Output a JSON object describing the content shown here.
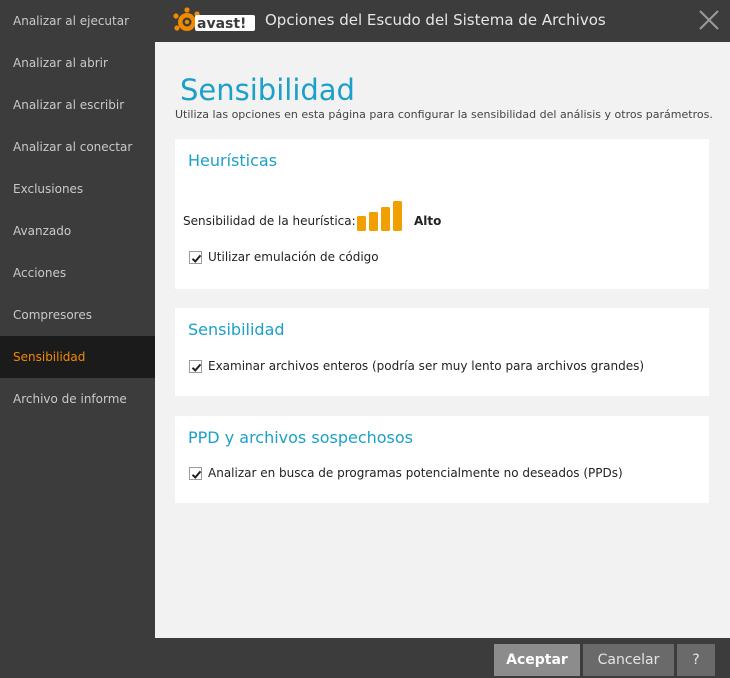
{
  "window": {
    "title": "Opciones del Escudo del Sistema de Archivos",
    "brand": "avast!"
  },
  "sidebar": {
    "items": [
      {
        "label": "Analizar al ejecutar"
      },
      {
        "label": "Analizar al abrir"
      },
      {
        "label": "Analizar al escribir"
      },
      {
        "label": "Analizar al conectar"
      },
      {
        "label": "Exclusiones"
      },
      {
        "label": "Avanzado"
      },
      {
        "label": "Acciones"
      },
      {
        "label": "Compresores"
      },
      {
        "label": "Sensibilidad",
        "active": true
      },
      {
        "label": "Archivo de informe"
      }
    ]
  },
  "page": {
    "title": "Sensibilidad",
    "intro": "Utiliza las opciones en esta página para configurar la sensibilidad del análisis y otros parámetros."
  },
  "heuristics": {
    "title": "Heurísticas",
    "sensitivity_label": "Sensibilidad de la heurística:",
    "level": "Alto",
    "level_bars": 4,
    "code_emulation": {
      "label": "Utilizar emulación de código",
      "checked": true
    }
  },
  "sensitivity": {
    "title": "Sensibilidad",
    "scan_whole_files": {
      "label": "Examinar archivos enteros (podría ser muy lento para archivos grandes)",
      "checked": true
    }
  },
  "pup": {
    "title": "PPD y archivos sospechosos",
    "scan_pups": {
      "label": "Analizar en busca de programas potencialmente no deseados (PPDs)",
      "checked": true
    }
  },
  "footer": {
    "accept": "Aceptar",
    "cancel": "Cancelar",
    "help": "?"
  },
  "colors": {
    "accent": "#1ba0c9",
    "brand": "#f08a00",
    "sidebar_bg": "#3c3c3c",
    "active_bg": "#1b1b1b"
  }
}
